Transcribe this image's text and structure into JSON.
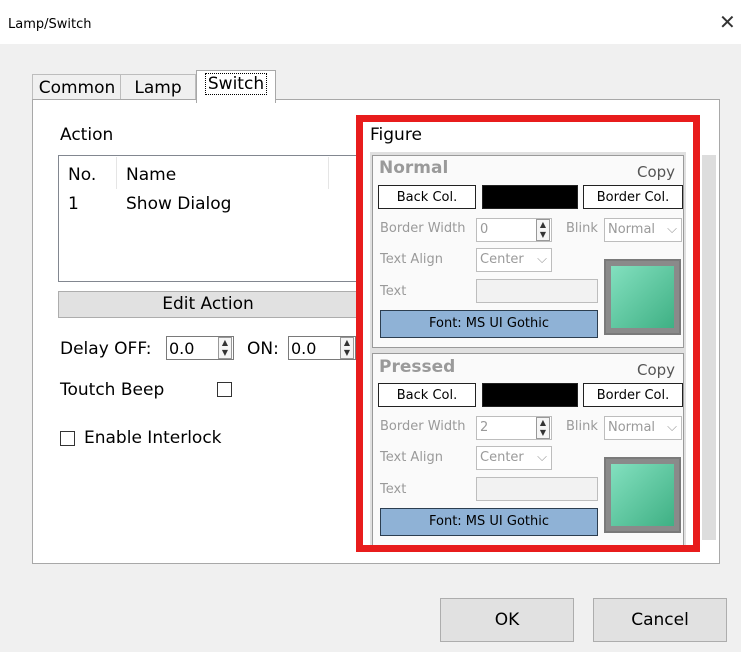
{
  "window": {
    "title": "Lamp/Switch",
    "close_glyph": "✕"
  },
  "tabs": [
    {
      "label": "Common"
    },
    {
      "label": "Lamp"
    },
    {
      "label": "Switch"
    }
  ],
  "action": {
    "label": "Action",
    "columns": [
      "No.",
      "Name"
    ],
    "rows": [
      {
        "no": "1",
        "name": "Show Dialog"
      }
    ],
    "edit_label": "Edit Action"
  },
  "delay": {
    "off_label": "Delay OFF:",
    "off_value": "0.0",
    "on_label": "ON:",
    "on_value": "0.0"
  },
  "beep": {
    "label": "Toutch Beep",
    "checked": false
  },
  "interlock": {
    "label": "Enable Interlock",
    "checked": false
  },
  "figure": {
    "label": "Figure",
    "normal": {
      "title": "Normal",
      "copy_label": "Copy",
      "back_col_label": "Back Col.",
      "border_col_label": "Border Col.",
      "back_color": "#000000",
      "border_width_label": "Border Width",
      "border_width_value": "0",
      "blink_label": "Blink",
      "blink_value": "Normal",
      "text_align_label": "Text Align",
      "text_align_value": "Center",
      "text_label": "Text",
      "text_value": "",
      "font_label": "Font: MS UI Gothic",
      "preview_color": "#5ccc9f"
    },
    "pressed": {
      "title": "Pressed",
      "copy_label": "Copy",
      "back_col_label": "Back Col.",
      "border_col_label": "Border Col.",
      "back_color": "#000000",
      "border_width_label": "Border Width",
      "border_width_value": "2",
      "blink_label": "Blink",
      "blink_value": "Normal",
      "text_align_label": "Text Align",
      "text_align_value": "Center",
      "text_label": "Text",
      "text_value": "",
      "font_label": "Font: MS UI Gothic",
      "preview_color": "#5ccc9f"
    }
  },
  "buttons": {
    "ok_label": "OK",
    "cancel_label": "Cancel"
  },
  "colors": {
    "highlight": "#e81c1c",
    "font_button": "#8fb2d6"
  }
}
